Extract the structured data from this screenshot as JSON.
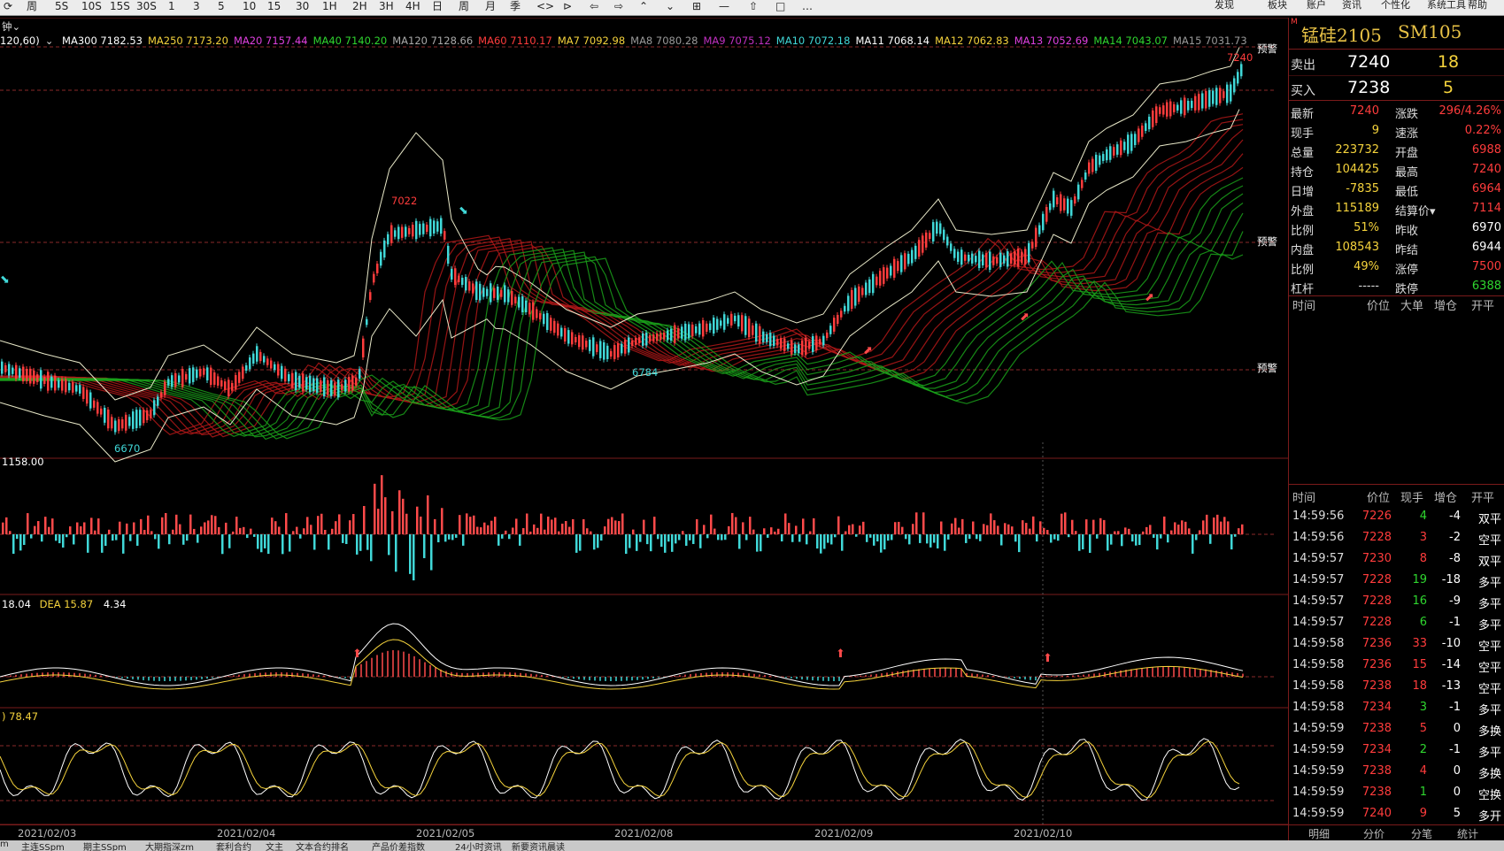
{
  "toolbar": {
    "items": [
      "⟳",
      "周",
      "5S",
      "10S",
      "15S",
      "30S",
      "1",
      "3",
      "5",
      "10",
      "15",
      "30",
      "1H",
      "2H",
      "3H",
      "4H",
      "日",
      "周",
      "月",
      "季",
      "<>",
      "⊳",
      "⇦",
      "⇨",
      "⌃",
      "⌄",
      "⊞",
      "—",
      "⇧",
      "□",
      "…"
    ],
    "right_items": [
      "发现",
      "板块",
      "账户",
      "资讯",
      "个性化",
      "系统工具",
      "帮助"
    ]
  },
  "main": {
    "period_label": "钟",
    "ma_prefix": "120,60)",
    "ma_values": [
      {
        "label": "MA300 7182.53",
        "color": "#ffffff"
      },
      {
        "label": "MA250 7173.20",
        "color": "#f5d33c"
      },
      {
        "label": "MA20 7157.44",
        "color": "#e040e0"
      },
      {
        "label": "MA40 7140.20",
        "color": "#2fd62f"
      },
      {
        "label": "MA120 7128.66",
        "color": "#aaaaaa"
      },
      {
        "label": "MA60 7110.17",
        "color": "#ff3c3c"
      },
      {
        "label": "MA7 7092.98",
        "color": "#f5d33c"
      },
      {
        "label": "MA8 7080.28",
        "color": "#999999"
      },
      {
        "label": "MA9 7075.12",
        "color": "#c030c0"
      },
      {
        "label": "MA10 7072.18",
        "color": "#40d8d8"
      },
      {
        "label": "MA11 7068.14",
        "color": "#ffffff"
      },
      {
        "label": "MA12 7062.83",
        "color": "#f5d33c"
      },
      {
        "label": "MA13 7052.69",
        "color": "#e040e0"
      },
      {
        "label": "MA14 7043.07",
        "color": "#2fd62f"
      },
      {
        "label": "MA15 7031.73",
        "color": "#999999"
      }
    ],
    "price_labels": {
      "high": "7240",
      "peak1": "7022",
      "low1": "6670",
      "low2": "6784"
    },
    "alerts": [
      "预警",
      "预警",
      "预警"
    ],
    "volume_label": "1158.00",
    "macd_label": {
      "dif": "18.04",
      "dea": "DEA 15.87",
      "macd": "4.34"
    },
    "kdj_label": "78.47",
    "dates": [
      "2021/02/03",
      "2021/02/04",
      "2021/02/05",
      "2021/02/08",
      "2021/02/09",
      "2021/02/10"
    ]
  },
  "panel": {
    "marker": "M",
    "name": "锰硅2105",
    "code": "SM105",
    "ask": {
      "label": "卖出",
      "price": "7240",
      "volume": "18"
    },
    "bid": {
      "label": "买入",
      "price": "7238",
      "volume": "5"
    },
    "stats_left": [
      {
        "k": "最新",
        "v": "7240",
        "color": "#ff3c3c"
      },
      {
        "k": "现手",
        "v": "9",
        "color": "#f5d33c"
      },
      {
        "k": "总量",
        "v": "223732",
        "color": "#f5d33c"
      },
      {
        "k": "持仓",
        "v": "104425",
        "color": "#f5d33c"
      },
      {
        "k": "日增",
        "v": "-7835",
        "color": "#f5d33c"
      },
      {
        "k": "外盘",
        "v": "115189",
        "color": "#f5d33c"
      },
      {
        "k": "比例",
        "v": "51%",
        "color": "#f5d33c"
      },
      {
        "k": "内盘",
        "v": "108543",
        "color": "#f5d33c"
      },
      {
        "k": "比例",
        "v": "49%",
        "color": "#f5d33c"
      },
      {
        "k": "杠杆",
        "v": "-----",
        "color": "#dddddd"
      }
    ],
    "stats_right": [
      {
        "k": "涨跌",
        "v": "296/4.26%",
        "color": "#ff3c3c"
      },
      {
        "k": "速涨",
        "v": "0.22%",
        "color": "#ff3c3c"
      },
      {
        "k": "开盘",
        "v": "6988",
        "color": "#ff3c3c"
      },
      {
        "k": "最高",
        "v": "7240",
        "color": "#ff3c3c"
      },
      {
        "k": "最低",
        "v": "6964",
        "color": "#ff3c3c"
      },
      {
        "k": "结算价▾",
        "v": "7114",
        "color": "#ff3c3c"
      },
      {
        "k": "昨收",
        "v": "6970",
        "color": "#ffffff"
      },
      {
        "k": "昨结",
        "v": "6944",
        "color": "#ffffff"
      },
      {
        "k": "涨停",
        "v": "7500",
        "color": "#ff3c3c"
      },
      {
        "k": "跌停",
        "v": "6388",
        "color": "#2fd62f"
      }
    ],
    "big_headers": [
      "时间",
      "价位",
      "大单",
      "增仓",
      "开平"
    ],
    "tick_headers": [
      "时间",
      "价位",
      "现手",
      "增仓",
      "开平"
    ],
    "ticks": [
      {
        "t": "14:59:56",
        "p": "7226",
        "v": "4",
        "vc": "#2fd62f",
        "d": "-4",
        "dc": "#ffffff",
        "o": "双平"
      },
      {
        "t": "14:59:56",
        "p": "7228",
        "v": "3",
        "vc": "#ff3c3c",
        "d": "-2",
        "dc": "#ffffff",
        "o": "空平"
      },
      {
        "t": "14:59:57",
        "p": "7230",
        "v": "8",
        "vc": "#ff3c3c",
        "d": "-8",
        "dc": "#ffffff",
        "o": "双平"
      },
      {
        "t": "14:59:57",
        "p": "7228",
        "v": "19",
        "vc": "#2fd62f",
        "d": "-18",
        "dc": "#ffffff",
        "o": "多平"
      },
      {
        "t": "14:59:57",
        "p": "7228",
        "v": "16",
        "vc": "#2fd62f",
        "d": "-9",
        "dc": "#ffffff",
        "o": "多平"
      },
      {
        "t": "14:59:57",
        "p": "7228",
        "v": "6",
        "vc": "#2fd62f",
        "d": "-1",
        "dc": "#ffffff",
        "o": "多平"
      },
      {
        "t": "14:59:58",
        "p": "7236",
        "v": "33",
        "vc": "#ff3c3c",
        "d": "-10",
        "dc": "#ffffff",
        "o": "空平"
      },
      {
        "t": "14:59:58",
        "p": "7236",
        "v": "15",
        "vc": "#ff3c3c",
        "d": "-14",
        "dc": "#ffffff",
        "o": "空平"
      },
      {
        "t": "14:59:58",
        "p": "7238",
        "v": "18",
        "vc": "#ff3c3c",
        "d": "-13",
        "dc": "#ffffff",
        "o": "空平"
      },
      {
        "t": "14:59:58",
        "p": "7234",
        "v": "3",
        "vc": "#2fd62f",
        "d": "-1",
        "dc": "#ffffff",
        "o": "多平"
      },
      {
        "t": "14:59:59",
        "p": "7238",
        "v": "5",
        "vc": "#ff3c3c",
        "d": "0",
        "dc": "#ffffff",
        "o": "多换"
      },
      {
        "t": "14:59:59",
        "p": "7234",
        "v": "2",
        "vc": "#2fd62f",
        "d": "-1",
        "dc": "#ffffff",
        "o": "多平"
      },
      {
        "t": "14:59:59",
        "p": "7238",
        "v": "4",
        "vc": "#ff3c3c",
        "d": "0",
        "dc": "#ffffff",
        "o": "多换"
      },
      {
        "t": "14:59:59",
        "p": "7238",
        "v": "1",
        "vc": "#2fd62f",
        "d": "0",
        "dc": "#ffffff",
        "o": "空换"
      },
      {
        "t": "14:59:59",
        "p": "7240",
        "v": "9",
        "vc": "#ff3c3c",
        "d": "5",
        "dc": "#ffffff",
        "o": "多开"
      }
    ],
    "tabs": [
      "明细",
      "分价",
      "分笔",
      "统计"
    ]
  },
  "bottom_bar": [
    "m",
    "主连SSpm",
    "期主SSpm",
    "大期指深zm",
    "套利合约",
    "文主",
    "文本合约排名",
    "产品价差指数",
    "24小时资讯",
    "新要资讯晨读"
  ]
}
